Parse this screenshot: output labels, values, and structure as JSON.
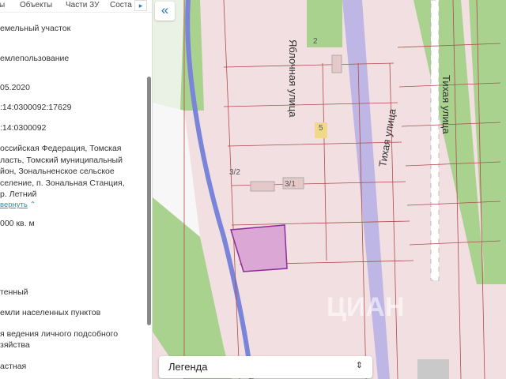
{
  "tabs": [
    "ы",
    "Объекты",
    "Части ЗУ",
    "Соста"
  ],
  "tab_next": "▸",
  "fields": [
    "емельный участок",
    "емлепользование",
    "05.2020",
    ":14:0300092:17629",
    ":14:0300092",
    "оссийская Федерация, Томская",
    "ласть, Томский муниципальный",
    "йон, Зональненское сельское",
    "селение, п. Зональная Станция,",
    "р. Летний",
    "000 кв. м",
    "тенный",
    "емли населенных пунктов",
    "я ведения личного подсобного",
    "зяйства",
    "астная"
  ],
  "collapse_link": "вернуть",
  "collapse_button": "«",
  "legend": {
    "label": "Легенда",
    "chevron": "⌃⌄"
  },
  "map": {
    "streets": [
      "Яблочная улица",
      "Тихая улица",
      "Тихая улица"
    ],
    "plots": [
      "2",
      "5",
      "3/2",
      "3/1"
    ],
    "watermark": "ЦИАН"
  }
}
